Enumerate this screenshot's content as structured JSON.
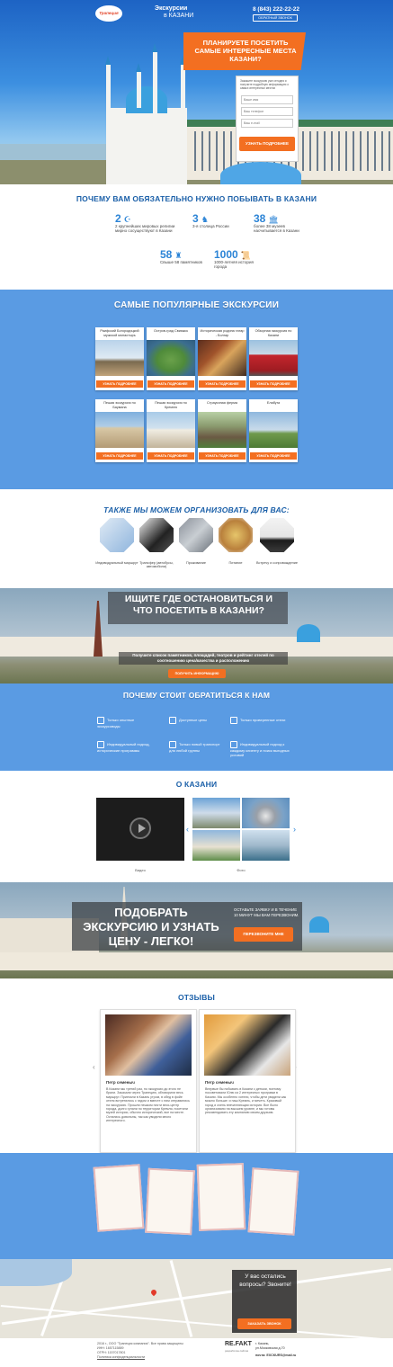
{
  "header": {
    "logo_text": "Трапеция",
    "brand_line1": "Экскурсии",
    "brand_line2": "в КАЗАНИ",
    "phone": "8 (843) 222-22-22",
    "callback": "ОБРАТНЫЙ ЗВОНОК"
  },
  "hero": {
    "headline": "ПЛАНИРУЕТЕ ПОСЕТИТЬ САМЫЕ ИНТЕРЕСНЫЕ МЕСТА КАЗАНИ?",
    "form_text": "Закажите экскурсию уже сегодня и получите подробную информацию о самых интересных местах",
    "ph_name": "Ваше имя",
    "ph_phone": "Ваш телефон",
    "ph_email": "Ваш e-mail",
    "submit": "УЗНАТЬ ПОДРОБНЕЕ"
  },
  "why": {
    "title": "ПОЧЕМУ ВАМ ОБЯЗАТЕЛЬНО НУЖНО ПОБЫВАТЬ В КАЗАНИ",
    "stats": [
      {
        "n": "2",
        "t": "2 крупнейших мировых религии мирно сосуществуют в Казани"
      },
      {
        "n": "3",
        "t": "3-я столица России"
      },
      {
        "n": "38",
        "t": "более 38 музеев насчитывается в Казани"
      },
      {
        "n": "58",
        "t": "Свыше 58 памятников"
      },
      {
        "n": "1000",
        "t": "1000-летняя история города"
      }
    ]
  },
  "tours": {
    "title": "САМЫЕ ПОПУЛЯРНЫЕ ЭКСКУРСИИ",
    "btn": "УЗНАТЬ ПОДРОБНЕЕ",
    "items": [
      "Раифский Богородицкий мужской монастырь",
      "Остров-град Свияжск",
      "Историческая родина татар - Болгар",
      "Обзорная экскурсия по Казани",
      "Пешая экскурсия по Баумана",
      "Пешая экскурсия по Кремлю",
      "Страусиная ферма",
      "Елабуга"
    ]
  },
  "org": {
    "title": "ТАКЖЕ МЫ МОЖЕМ ОРГАНИЗОВАТЬ ДЛЯ ВАС:",
    "items": [
      "Индивидуальный маршрут",
      "Трансфер (автобусы, автомобили)",
      "Проживание",
      "Питание",
      "Встречу и сопровождение"
    ]
  },
  "find": {
    "headline": "ИЩИТЕ ГДЕ ОСТАНОВИТЬСЯ И ЧТО ПОСЕТИТЬ В КАЗАНИ?",
    "sub": "Получите список памятников, площадей, театров и рейтинг отелей по соотношению цена/качества и расположению",
    "btn": "ПОЛУЧИТЬ ИНФОРМАЦИЮ"
  },
  "benefits": {
    "title": "ПОЧЕМУ СТОИТ ОБРАТИТЬСЯ К НАМ",
    "items": [
      "Только опытные экскурсоводы",
      "Доступные цены",
      "Только проверенные отели",
      "Индивидуальный подход, исторические программы",
      "Только новый транспорт для любой группы",
      "Индивидуальный подход к каждому клиенту и поиск выгодных условий"
    ]
  },
  "about": {
    "title": "О КАЗАНИ",
    "video": "Видео",
    "photo": "Фото"
  },
  "price": {
    "headline": "ПОДОБРАТЬ ЭКСКУРСИЮ И УЗНАТЬ ЦЕНУ - ЛЕГКО!",
    "text": "ОСТАВЬТЕ ЗАЯВКУ И В ТЕЧЕНИЕ 10 МИНУТ МЫ ВАМ ПЕРЕЗВОНИМ.",
    "btn": "ПЕРЕЗВОНИТЕ МНЕ"
  },
  "reviews": {
    "title": "ОТЗЫВЫ",
    "items": [
      {
        "name": "Петр семеныч",
        "text": "В Казани мы третий раз, но экскурсии до этого не брали. Заказали через Трапецию, обговорили весь маршрут. Приехали в Казань утром, в обед в фойе отеля встретились с гидом и вместе с ним отправились на экскурсию. Прошли пешком почти весь центр города, долго гуляли по территории Кремля, посетили музей истории, обычно исторический, все на месте. Остались довольны, так как увидели много интересного."
      },
      {
        "name": "Петр семеныч",
        "text": "Впервые бы побывать в Казани с детьми, поэтому посоветовали Юлю из 2 интересных программ в Казани. Мы особенно хотели, чтобы дети увидели как можно больше: и наш Кремль, и мечеть. Красивый город и очень впечатляющая история. Все было организовано на высшем уровне, и мы готовы рекомендовать эту компанию своим друзьям."
      }
    ]
  },
  "footer": {
    "copy": "2016 г., ООО \"Трапеция компания\". Все права защищены",
    "inn": "ИНН: 1657115889",
    "ogrn": "ОГРН: 1157017801",
    "policy": "Политика конфиденциальности",
    "dev": "RE.FAKT",
    "dev_sub": "разработка сайтов",
    "addr1": "г. Казань,",
    "addr2": "ул.Московская д.70",
    "mail": "почта: EXCKURS@mail.ru"
  },
  "map_box": {
    "q": "У вас остались вопросы? Звоните!",
    "btn": "ЗАКАЗАТЬ ЗВОНОК"
  },
  "colors": {
    "accent": "#f36f21",
    "blue": "#5a9be3",
    "title_blue": "#1a5fa8"
  }
}
